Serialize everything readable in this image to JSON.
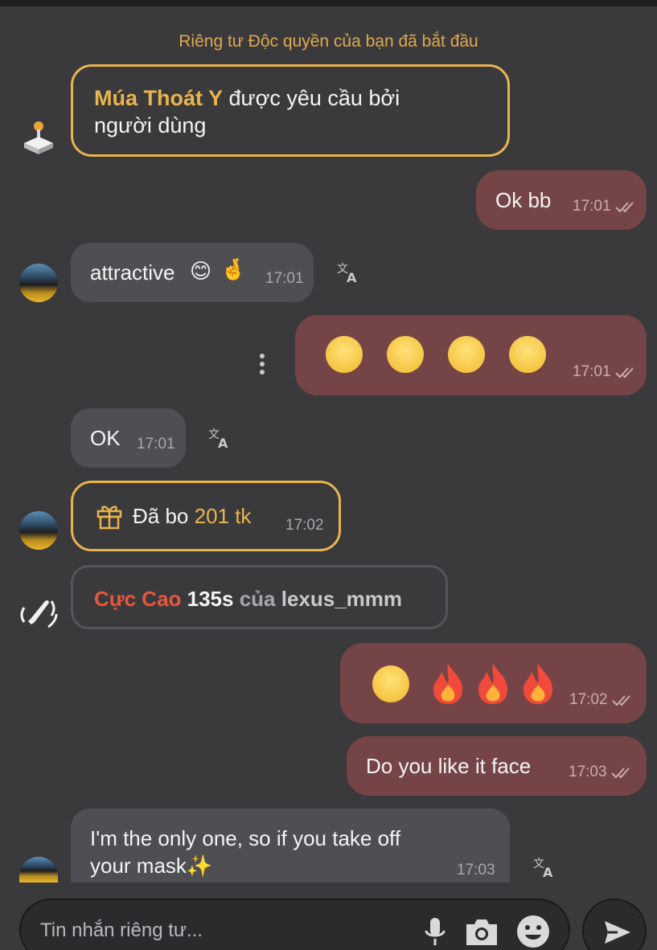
{
  "header": {
    "system_note": "Riêng tư Độc quyền của bạn đã bắt đầu"
  },
  "request": {
    "title": "Múa Thoát Y",
    "text_1": " được yêu cầu bởi",
    "text_2": "người dùng"
  },
  "messages": {
    "m1": {
      "text": "Ok bb",
      "time": "17:01"
    },
    "m2": {
      "text": "attractive",
      "time": "17:01"
    },
    "m3": {
      "time": "17:01"
    },
    "m4": {
      "text": "OK",
      "time": "17:01"
    },
    "m5": {
      "text": "Đã bo ",
      "amount": "201 tk",
      "time": "17:02"
    },
    "m6": {
      "level": "Cực Cao",
      "duration": " 135s",
      "of": " của",
      "user": " lexus_mmm"
    },
    "m7": {
      "time": "17:02"
    },
    "m8": {
      "text": "Do you like it face",
      "time": "17:03"
    },
    "m9": {
      "line1": "I'm the only one, so if you take off",
      "line2": "your mask✨",
      "time": "17:03"
    }
  },
  "composer": {
    "placeholder": "Tin nhắn riêng tư..."
  },
  "colors": {
    "accent": "#e9b44c",
    "outgoing": "#754446",
    "incoming": "#4f4f53",
    "hot": "#e8553a"
  }
}
